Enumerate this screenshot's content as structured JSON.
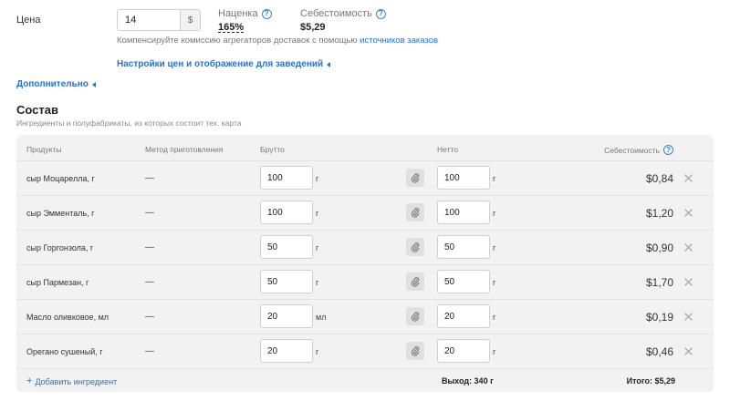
{
  "price": {
    "label": "Цена",
    "value": "14",
    "currency": "$"
  },
  "markup": {
    "label": "Наценка",
    "value": "165%"
  },
  "cost": {
    "label": "Себестоимость",
    "value": "$5,29"
  },
  "commission_hint": {
    "text": "Компенсируйте комиссию агрегаторов доставок с помощью ",
    "link": "источников заказов"
  },
  "venue_settings_link": "Настройки цен и отображение для заведений",
  "advanced_link": "Дополнительно",
  "composition": {
    "title": "Состав",
    "subtitle": "Ингредиенты и полуфабрикаты, из которых состоит тех. карта",
    "headers": {
      "products": "Продукты",
      "method": "Метод приготовления",
      "gross": "Брутто",
      "net": "Нетто",
      "cost": "Себестоимость"
    },
    "rows": [
      {
        "product": "сыр Моцарелла, г",
        "method": "—",
        "gross": "100",
        "gross_unit": "г",
        "net": "100",
        "net_unit": "г",
        "cost": "$0,84"
      },
      {
        "product": "сыр Эмменталь, г",
        "method": "—",
        "gross": "100",
        "gross_unit": "г",
        "net": "100",
        "net_unit": "г",
        "cost": "$1,20"
      },
      {
        "product": "сыр Горгонзола, г",
        "method": "—",
        "gross": "50",
        "gross_unit": "г",
        "net": "50",
        "net_unit": "г",
        "cost": "$0,90"
      },
      {
        "product": "сыр Пармезан, г",
        "method": "—",
        "gross": "50",
        "gross_unit": "г",
        "net": "50",
        "net_unit": "г",
        "cost": "$1,70"
      },
      {
        "product": "Масло оливковое, мл",
        "method": "—",
        "gross": "20",
        "gross_unit": "мл",
        "net": "20",
        "net_unit": "г",
        "cost": "$0,19"
      },
      {
        "product": "Орегано сушеный, г",
        "method": "—",
        "gross": "20",
        "gross_unit": "г",
        "net": "20",
        "net_unit": "г",
        "cost": "$0,46"
      }
    ],
    "add_ingredient": "Добавить ингредиент",
    "yield_total": "Выход: 340 г",
    "grand_total": "Итого: $5,29"
  },
  "icons": {
    "help": "question-circle-icon",
    "clip": "paperclip-icon",
    "remove": "close-icon",
    "caret": "caret-left-icon",
    "add": "plus-icon"
  },
  "colors": {
    "link": "#2a72c9",
    "panel_bg": "#f2f2f2"
  }
}
